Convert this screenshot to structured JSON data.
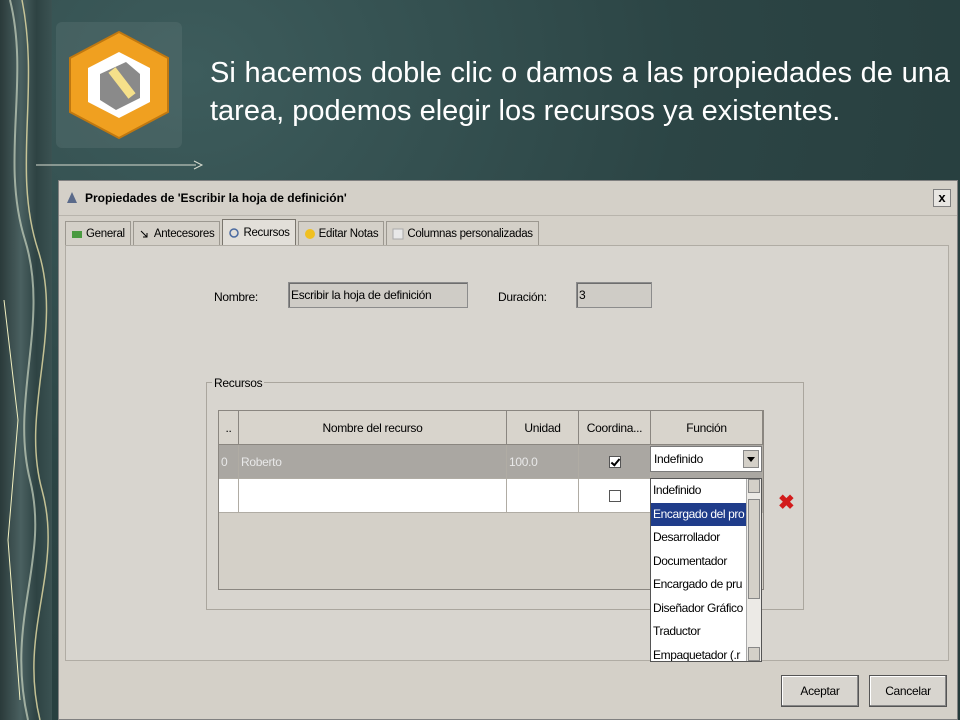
{
  "slide": {
    "text": "Si hacemos doble clic o damos a las propiedades de una tarea, podemos elegir los recursos ya existentes."
  },
  "dialog": {
    "title": "Propiedades de 'Escribir la hoja de definición'",
    "close_label": "x",
    "tabs": [
      {
        "label": "General",
        "icon": "general-icon"
      },
      {
        "label": "Antecesores",
        "icon": "arrow-icon"
      },
      {
        "label": "Recursos",
        "icon": "resources-icon",
        "active": true
      },
      {
        "label": "Editar Notas",
        "icon": "notes-icon"
      },
      {
        "label": "Columnas personalizadas",
        "icon": "columns-icon"
      }
    ],
    "name_label": "Nombre:",
    "name_value": "Escribir la hoja de definición",
    "duration_label": "Duración:",
    "duration_value": "3",
    "resources_group": "Recursos",
    "grid": {
      "headers": [
        "..",
        "Nombre del recurso",
        "Unidad",
        "Coordina...",
        "Función"
      ],
      "rows": [
        {
          "id": "0",
          "name": "Roberto",
          "unit": "100.0",
          "coordinator": true,
          "function": "Indefinido"
        },
        {
          "id": "",
          "name": "",
          "unit": "",
          "coordinator": false,
          "function": ""
        }
      ]
    },
    "combo_value": "Indefinido",
    "dropdown_options": [
      "Indefinido",
      "Encargado del pro",
      "Desarrollador",
      "Documentador",
      "Encargado de pru",
      "Diseñador Gráfico",
      "Traductor",
      "Empaquetador (.r"
    ],
    "selected_option": 1,
    "delete_symbol": "✖",
    "buttons": {
      "ok": "Aceptar",
      "cancel": "Cancelar"
    }
  },
  "colors": {
    "selection": "#1f3c8a",
    "delete": "#d21b1b",
    "logo_orange": "#f0a020"
  }
}
